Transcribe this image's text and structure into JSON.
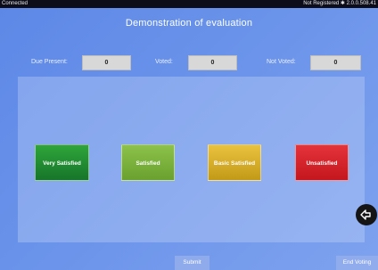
{
  "status_bar": {
    "connection": "Connected",
    "registration": "Not Registered",
    "version": "2.0.0.508.41"
  },
  "title": "Demonstration of evaluation",
  "stats": [
    {
      "label": "Due Present:",
      "value": "0"
    },
    {
      "label": "Voted:",
      "value": "0"
    },
    {
      "label": "Not Voted:",
      "value": "0"
    }
  ],
  "evaluation_options": [
    {
      "label": "Very Satisfied",
      "color": "#1f8a2b"
    },
    {
      "label": "Satisfied",
      "color": "#7bb23a"
    },
    {
      "label": "Basic Satisfied",
      "color": "#d8b22b"
    },
    {
      "label": "Unsatisfied",
      "color": "#d6202a"
    }
  ],
  "submit_label": "Submit",
  "end_voting_label": "End Voting",
  "icons": {
    "back": "back-arrow-icon",
    "bluetooth": "bluetooth-icon"
  }
}
